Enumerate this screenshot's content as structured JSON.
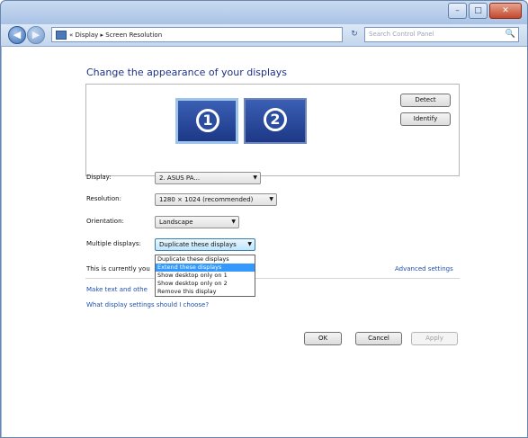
{
  "window": {
    "minimize_glyph": "–",
    "maximize_glyph": "□",
    "close_glyph": "✕"
  },
  "nav": {
    "back_glyph": "◀",
    "forward_glyph": "▶",
    "breadcrumb": "« Display ▸ Screen Resolution",
    "refresh_glyph": "↻",
    "search_placeholder": "Search Control Panel",
    "search_icon": "🔍"
  },
  "main": {
    "heading": "Change the appearance of your displays",
    "monitors": [
      {
        "number": "1",
        "selected": true
      },
      {
        "number": "2",
        "selected": false
      }
    ],
    "detect_label": "Detect",
    "identify_label": "Identify",
    "display_label": "Display:",
    "display_value": "2. ASUS PA...",
    "resolution_label": "Resolution:",
    "resolution_value": "1280 × 1024 (recommended)",
    "orientation_label": "Orientation:",
    "orientation_value": "Landscape",
    "multiple_label": "Multiple displays:",
    "multiple_value": "Duplicate these displays",
    "multiple_options": [
      "Duplicate these displays",
      "Extend these displays",
      "Show desktop only on 1",
      "Show desktop only on 2",
      "Remove this display"
    ],
    "highlighted_option": 1,
    "status_text": "This is currently you",
    "advanced_link": "Advanced settings",
    "make_text_link": "Make text and othe",
    "which_settings_link": "What display settings should I choose?",
    "ok_label": "OK",
    "cancel_label": "Cancel",
    "apply_label": "Apply"
  },
  "colors": {
    "heading": "#1e3287",
    "link": "#1f4fb0",
    "highlight": "#3399ff"
  }
}
